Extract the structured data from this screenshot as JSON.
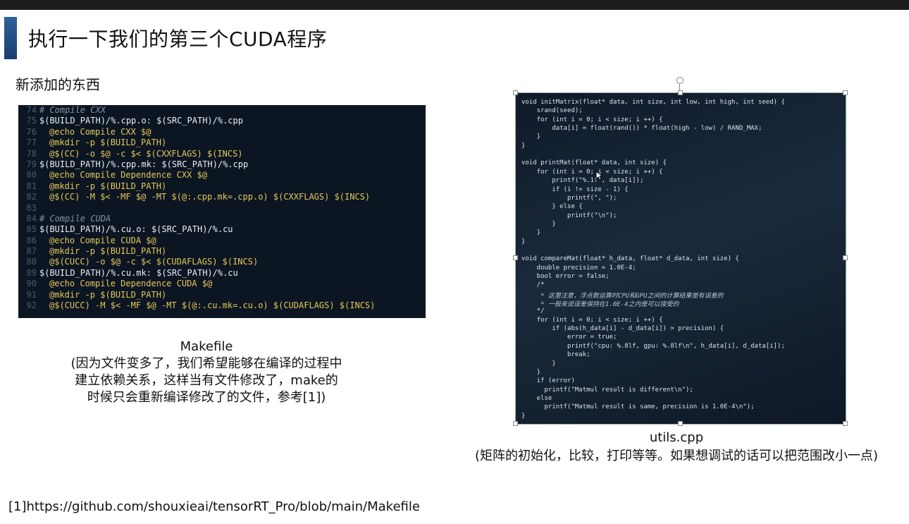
{
  "slide": {
    "title": "执行一下我们的第三个CUDA程序",
    "subtitle": "新添加的东西",
    "footnote": "[1]https://github.com/shouxieai/tensorRT_Pro/blob/main/Makefile"
  },
  "makefile": {
    "lines": [
      {
        "n": "74",
        "t": "# Compile CXX",
        "k": "comment"
      },
      {
        "n": "75",
        "t": "$(BUILD_PATH)/%.cpp.o: $(SRC_PATH)/%.cpp",
        "k": "target"
      },
      {
        "n": "76",
        "t": "@echo Compile CXX $@",
        "k": "cmd"
      },
      {
        "n": "77",
        "t": "@mkdir -p $(BUILD_PATH)",
        "k": "cmd"
      },
      {
        "n": "78",
        "t": "@$(CC) -o $@ -c $< $(CXXFLAGS) $(INCS)",
        "k": "cmd"
      },
      {
        "n": "79",
        "t": "$(BUILD_PATH)/%.cpp.mk: $(SRC_PATH)/%.cpp",
        "k": "target"
      },
      {
        "n": "80",
        "t": "@echo Compile Dependence CXX $@",
        "k": "cmd"
      },
      {
        "n": "81",
        "t": "@mkdir -p $(BUILD_PATH)",
        "k": "cmd"
      },
      {
        "n": "82",
        "t": "@$(CC) -M $< -MF $@ -MT $(@:.cpp.mk=.cpp.o) $(CXXFLAGS) $(INCS)",
        "k": "cmd"
      },
      {
        "n": "83",
        "t": "",
        "k": "target"
      },
      {
        "n": "84",
        "t": "# Compile CUDA",
        "k": "comment"
      },
      {
        "n": "85",
        "t": "$(BUILD_PATH)/%.cu.o: $(SRC_PATH)/%.cu",
        "k": "target"
      },
      {
        "n": "86",
        "t": "@echo Compile CUDA $@",
        "k": "cmd"
      },
      {
        "n": "87",
        "t": "@mkdir -p $(BUILD_PATH)",
        "k": "cmd"
      },
      {
        "n": "88",
        "t": "@$(CUCC) -o $@ -c $< $(CUDAFLAGS) $(INCS)",
        "k": "cmd"
      },
      {
        "n": "89",
        "t": "$(BUILD_PATH)/%.cu.mk: $(SRC_PATH)/%.cu",
        "k": "target"
      },
      {
        "n": "90",
        "t": "@echo Compile Dependence CUDA $@",
        "k": "cmd"
      },
      {
        "n": "91",
        "t": "@mkdir -p $(BUILD_PATH)",
        "k": "cmd"
      },
      {
        "n": "92",
        "t": "@$(CUCC) -M $< -MF $@ -MT $(@:.cu.mk=.cu.o) $(CUDAFLAGS) $(INCS)",
        "k": "cmd"
      }
    ],
    "caption_title": "Makefile",
    "caption_body": "(因为文件变多了，我们希望能够在编译的过程中建立依赖关系，这样当有文件修改了，make的时候只会重新编译修改了的文件，参考[1])"
  },
  "utils": {
    "lines": [
      {
        "t": "void initMatrix(float* data, int size, int low, int high, int seed) {"
      },
      {
        "t": "    srand(seed);"
      },
      {
        "t": "    for (int i = 0; i < size; i ++) {"
      },
      {
        "t": "        data[i] = float(rand()) * float(high - low) / RAND_MAX;"
      },
      {
        "t": "    }"
      },
      {
        "t": "}"
      },
      {
        "t": ""
      },
      {
        "t": "void printMat(float* data, int size) {"
      },
      {
        "t": "    for (int i = 0; i < size; i ++) {"
      },
      {
        "t": "        printf(\"%.1f\", data[i]);"
      },
      {
        "t": "        if (i != size - 1) {"
      },
      {
        "t": "            printf(\", \");"
      },
      {
        "t": "        } else {"
      },
      {
        "t": "            printf(\"\\n\");"
      },
      {
        "t": "        }"
      },
      {
        "t": "    }"
      },
      {
        "t": "}"
      },
      {
        "t": ""
      },
      {
        "t": "void compareMat(float* h_data, float* d_data, int size) {"
      },
      {
        "t": "    double precision = 1.0E-4;"
      },
      {
        "t": "    bool error = false;"
      },
      {
        "t": "    /*"
      },
      {
        "t": "     * 这里注意，浮点数运算时CPU和GPU之间的计算结果是有误差的",
        "c": true
      },
      {
        "t": "     * 一般来说误差保持在1.0E-4之内是可以接受的",
        "c": true
      },
      {
        "t": "    */"
      },
      {
        "t": "    for (int i = 0; i < size; i ++) {"
      },
      {
        "t": "        if (abs(h_data[i] - d_data[i]) > precision) {"
      },
      {
        "t": "            error = true;"
      },
      {
        "t": "            printf(\"cpu: %.8lf, gpu: %.8lf\\n\", h_data[i], d_data[i]);"
      },
      {
        "t": "            break;"
      },
      {
        "t": "        }"
      },
      {
        "t": "    }"
      },
      {
        "t": "    if (error)"
      },
      {
        "t": "      printf(\"Matmul result is different\\n\");"
      },
      {
        "t": "    else"
      },
      {
        "t": "      printf(\"Matmul result is same, precision is 1.0E-4\\n\");"
      },
      {
        "t": "}"
      }
    ],
    "caption_title": "utils.cpp",
    "caption_body": "(矩阵的初始化，比较，打印等等。如果想调试的话可以把范围改小一点)"
  }
}
